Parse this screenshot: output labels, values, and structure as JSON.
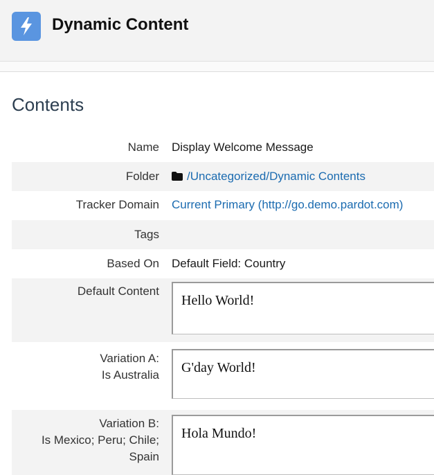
{
  "header": {
    "title": "Dynamic Content",
    "icon": "lightning-bolt-icon",
    "icon_color": "#5a95e0"
  },
  "section": {
    "title": "Contents"
  },
  "fields": {
    "name": {
      "label": "Name",
      "value": "Display Welcome Message"
    },
    "folder": {
      "label": "Folder",
      "value": "/Uncategorized/Dynamic Contents",
      "icon": "folder-icon"
    },
    "tracker_domain": {
      "label": "Tracker Domain",
      "value": "Current Primary (http://go.demo.pardot.com)"
    },
    "tags": {
      "label": "Tags",
      "value": ""
    },
    "based_on": {
      "label": "Based On",
      "value": "Default Field: Country"
    },
    "default_content": {
      "label": "Default Content",
      "value": "Hello World!"
    },
    "variation_a": {
      "label_line1": "Variation A:",
      "label_line2": "Is Australia",
      "value": "G'day World!"
    },
    "variation_b": {
      "label_line1": "Variation B:",
      "label_line2": "Is Mexico; Peru; Chile;",
      "label_line3": "Spain",
      "value": "Hola Mundo!"
    }
  },
  "colors": {
    "link": "#1b6bb0",
    "row_shade": "#f3f3f3"
  }
}
